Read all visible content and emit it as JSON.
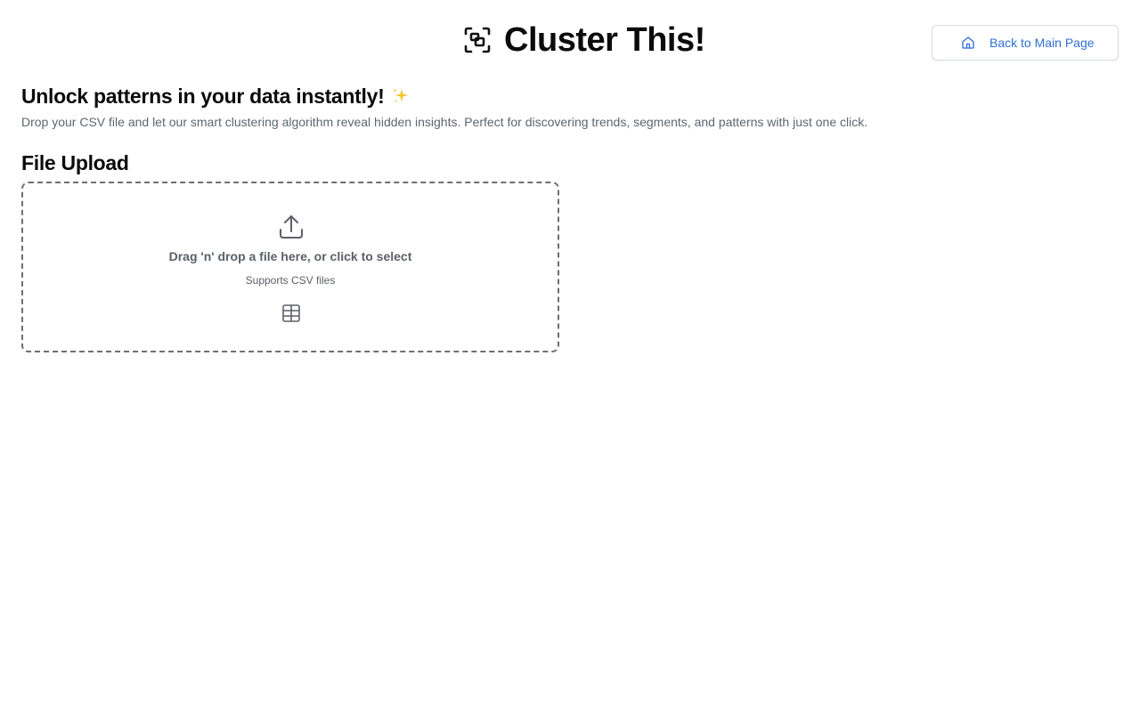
{
  "header": {
    "app_icon": "scan-frame-icon",
    "title": "Cluster This!",
    "back_button": {
      "icon": "home-icon",
      "label": "Back to Main Page"
    }
  },
  "intro": {
    "headline": "Unlock patterns in your data instantly!",
    "headline_icon": "sparkles-icon",
    "description": "Drop your CSV file and let our smart clustering algorithm reveal hidden insights. Perfect for discovering trends, segments, and patterns with just one click."
  },
  "upload": {
    "section_title": "File Upload",
    "dropzone": {
      "icon": "upload-icon",
      "primary_text": "Drag 'n' drop a file here, or click to select",
      "secondary_text": "Supports CSV files",
      "file_type_icon": "table-icon"
    }
  },
  "colors": {
    "link_blue": "#2f6fd6",
    "text_dark": "#0b0b0b",
    "text_muted": "#5e6670",
    "dropzone_border": "#6f6f6f",
    "sparkle_gold": "#f4c430"
  }
}
